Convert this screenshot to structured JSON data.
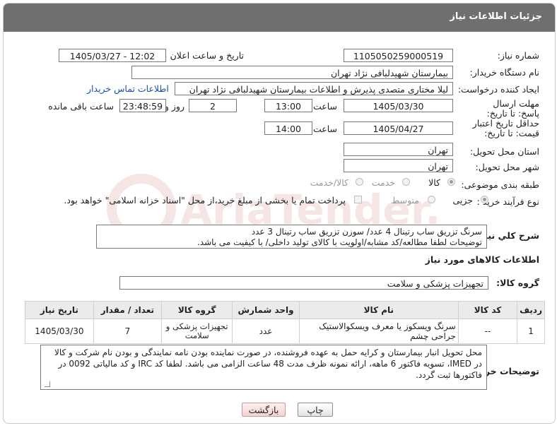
{
  "header": {
    "title": "جزئیات اطلاعات نیاز"
  },
  "labels": {
    "need_number": "شماره نیاز:",
    "announce_datetime": "تاریخ و ساعت اعلان عمومی:",
    "buyer_org": "نام دستگاه خریدار:",
    "requester": "ایجاد کننده درخواست:",
    "reply_deadline": "مهلت ارسال پاسخ: تا تاریخ:",
    "price_validity": "حداقل تاریخ اعتبار قیمت: تا تاریخ:",
    "hour": "ساعت",
    "day_and": "روز و",
    "hours_left": "ساعت باقی مانده",
    "delivery_province": "استان محل تحویل:",
    "delivery_city": "شهر محل تحویل:",
    "category": "طبقه بندی موضوعی:",
    "purchase_type": "نوع فرآیند خرید :",
    "summary": "شرح کلي نياز:",
    "goods_info": "اطلاعات کالاهای مورد نیاز",
    "goods_group": "گروه کالا:",
    "buyer_notes": "توضیحات خریدار:"
  },
  "fields": {
    "need_number": "1105050259000519",
    "announce_datetime": "1405/03/27 - 12:02",
    "buyer_org": "بیمارستان شهیدلبافی نژاد تهران",
    "requester": "لیلا مختاری متصدی پذیرش و اطلاعات بیمارستان شهیدلبافی نژاد تهران",
    "contact_link": "اطلاعات تماس خریدار",
    "reply_date": "1405/03/30",
    "reply_time": "13:00",
    "reply_days": "2",
    "reply_remaining": "23:48:59",
    "validity_date": "1405/04/27",
    "validity_time": "14:00",
    "province": "تهران",
    "city": "تهران",
    "goods_group": "تجهیزات پزشکی و سلامت"
  },
  "category_options": [
    "کالا",
    "خدمت",
    "کالا/خدمت"
  ],
  "category_selected": "کالا",
  "purchase_options": [
    "جزیی",
    "متوسط"
  ],
  "purchase_selected": "جزیی",
  "payment_note": "پرداخت تمام یا بخشی از مبلغ خرید،از محل \"اسناد خزانه اسلامی\" خواهد بود.",
  "summary_lines": [
    "سرنگ  تزریق ساب رتینال 4 عدد/ سوزن تزریق ساب رتینال 3 عدد",
    "توضیحات لطفا مطالعه/کد مشابه/اولویت با کالای تولید داخلی/ با کیفیت می باشد."
  ],
  "table": {
    "headers": [
      "ردیف",
      "کد کالا",
      "نام کالا",
      "واحد شمارش",
      "گروه کالا",
      "تعداد / مقدار",
      "تاریخ نیاز"
    ],
    "rows": [
      [
        "1",
        "--",
        "سرنگ ویسکوز یا معرف ویسکوالاستیک جراحی چشم",
        "عدد",
        "تجهیزات پزشکی و سلامت",
        "7",
        "1405/03/30"
      ]
    ]
  },
  "buyer_notes_text": "محل تحویل انبار بیمارستان و کرایه حمل به عهده فروشنده، در صورت نماینده بودن نامه نمایندگی و بودن نام شرکت و کالا در IMED، تسویه فاکتور 6 ماهه، ارائه نمونه ظرف مدت 48 ساعت الزامی می باشد. لطفا کد IRC و کد مالیاتی 0092 در فاکتورها ثبت گردد.",
  "buttons": {
    "print": "چاپ",
    "back": "بازگشت"
  },
  "watermark": "AriaTender.net"
}
